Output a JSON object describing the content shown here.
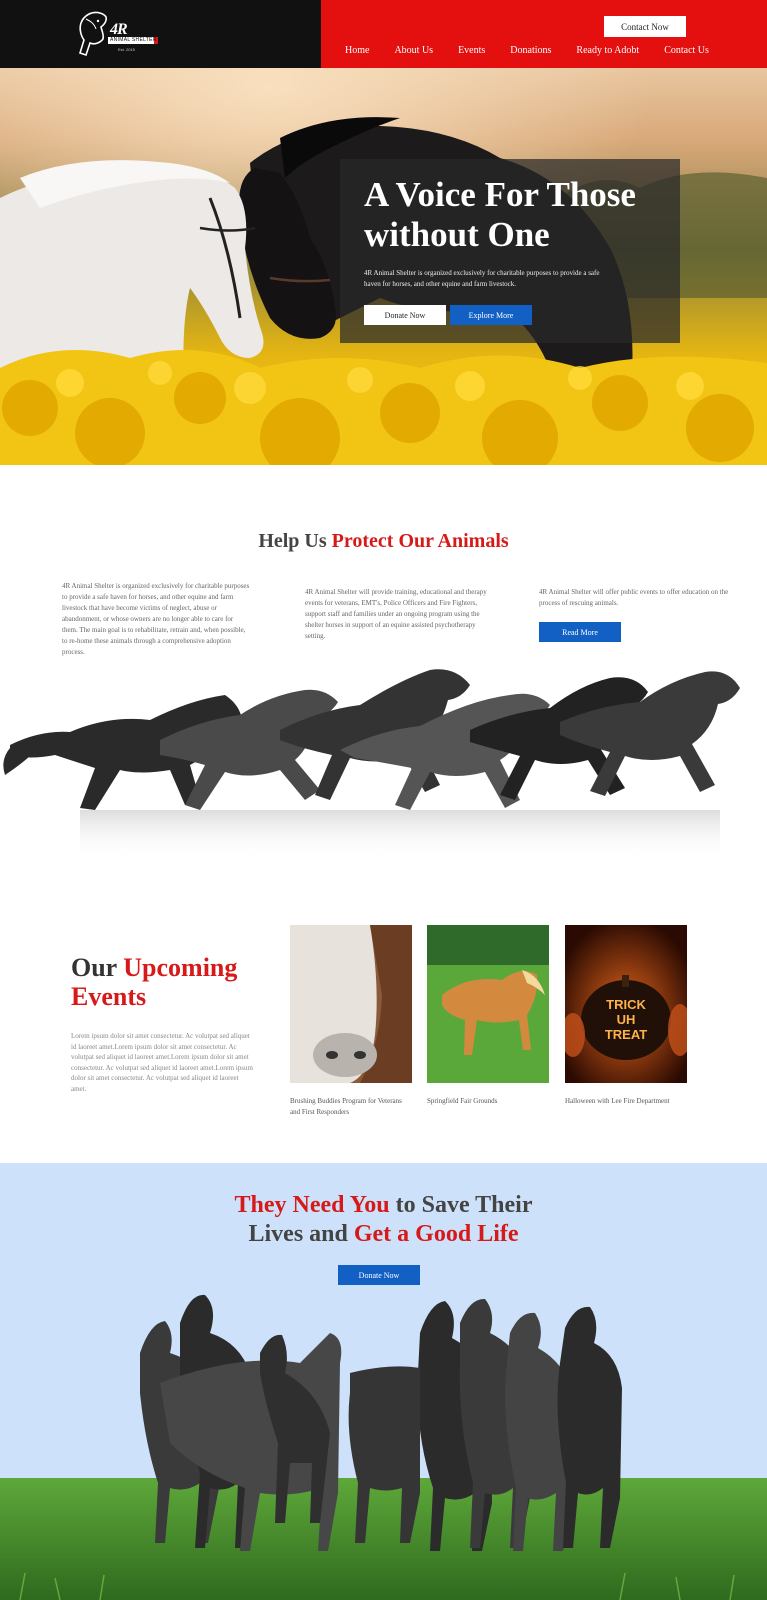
{
  "header": {
    "logo_mark": "4R",
    "logo_name": "ANIMAL SHELTER",
    "logo_est": "Est. 2015",
    "contact_btn": "Contact Now",
    "nav": [
      "Home",
      "About Us",
      "Events",
      "Donations",
      "Ready to Adobt",
      "Contact Us"
    ]
  },
  "hero": {
    "title": "A Voice For Those without One",
    "text": "4R Animal Shelter is organized exclusively for charitable purposes to provide a safe haven for horses, and other equine and farm livestock.",
    "btn_donate": "Donate Now",
    "btn_explore": "Explore More"
  },
  "help": {
    "title_plain": "Help Us ",
    "title_red": "Protect Our Animals",
    "col1": "4R Animal Shelter is organized exclusively for charitable purposes to provide a safe haven for horses, and other equine and farm livestock that have become victims of neglect, abuse or abandonment, or whose owners are no longer able to care for them. The main goal is to rehabilitate, retrain and, when possible, to re-home these animals through a comprehensive adoption process.",
    "col2": "4R Animal Shelter will provide training, educational and therapy events for veterans, EMT's, Police Officers and Fire Fighters, support staff and families under an ongoing program using the shelter horses in support of an equine assisted psychotherapy setting.",
    "col3": "4R Animal Shelter will offer public events to offer education on the process of rescuing animals.",
    "read_more": "Read More"
  },
  "events": {
    "title_plain": "Our ",
    "title_red_1": "Upcoming",
    "title_red_2": "Events",
    "lorem": "Lorem ipsum dolor sit amet consectetur. Ac volutpat sed aliquet id laoreet amet.Lorem ipsum dolor sit amet consectetur. Ac volutpat sed aliquet id laoreet amet.Lorem ipsum dolor sit amet consectetur. Ac volutpat sed aliquet id laoreet amet.Lorem ipsum dolor sit amet consectetur. Ac volutpat sed aliquet id laoreet amet.",
    "cards": [
      {
        "caption": "Brushing Buddies Program for Veterans and First Responders"
      },
      {
        "caption": "Springfield Fair Grounds"
      },
      {
        "caption": "Halloween with Lee Fire Department"
      }
    ],
    "pumpkin_text": "TRICK UH TREAT"
  },
  "save": {
    "title_red_1": "They Need You",
    "title_plain_1": " to Save Their",
    "title_plain_2": "Lives and ",
    "title_red_2": "Get a Good Life",
    "btn": "Donate Now"
  },
  "colors": {
    "accent_red": "#d61a1a",
    "header_red": "#e40f0f",
    "button_blue": "#1260c4",
    "header_black": "#111111",
    "sky_blue": "#cde2fa"
  }
}
